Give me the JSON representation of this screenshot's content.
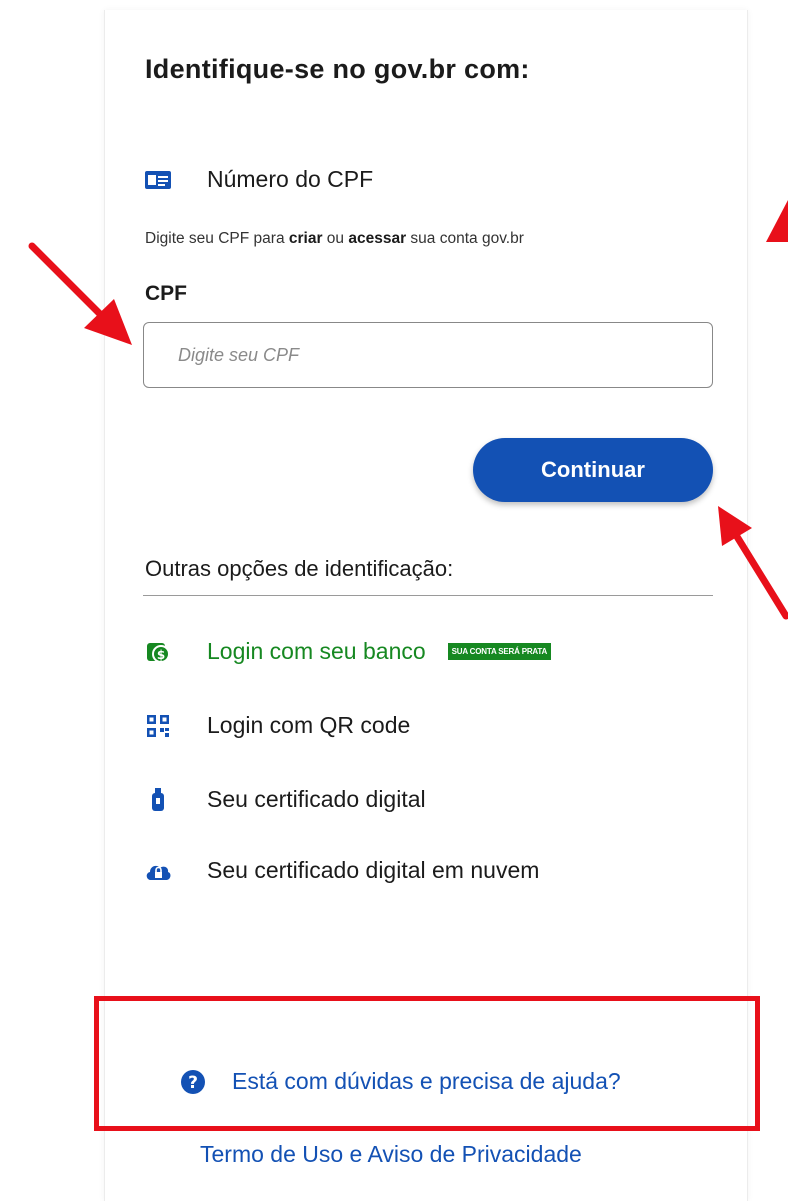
{
  "login": {
    "title": "Identifique-se no gov.br com:",
    "method_label": "Número do CPF",
    "helper": {
      "part1": "Digite seu CPF para ",
      "bold1": "criar",
      "part2": " ou ",
      "bold2": "acessar",
      "part3": " sua conta gov.br"
    },
    "cpf_label": "CPF",
    "cpf_placeholder": "Digite seu CPF",
    "continue_label": "Continuar"
  },
  "other_options": {
    "title": "Outras opções de identificação:",
    "bank_label": "Login com seu banco",
    "bank_badge": "SUA CONTA SERÁ PRATA",
    "qr_label": "Login com QR code",
    "cert_label": "Seu certificado digital",
    "cloud_cert_label": "Seu certificado digital em nuvem"
  },
  "footer": {
    "help_label": "Está com dúvidas e precisa de ajuda?",
    "terms_label": "Termo de Uso e Aviso de Privacidade"
  },
  "colors": {
    "primary_blue": "#1351b4",
    "bank_green": "#168821",
    "annotation_red": "#e8101a"
  },
  "icons": {
    "cpf": "id-card-icon",
    "bank": "bank-money-icon",
    "qr": "qr-code-icon",
    "cert": "usb-token-icon",
    "cloud": "cloud-lock-icon",
    "help": "question-circle-icon"
  }
}
